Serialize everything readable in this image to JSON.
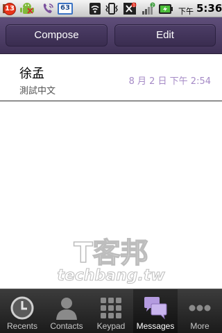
{
  "status_bar": {
    "notification_count": "13",
    "calendar_number": "63",
    "ampm": "下午",
    "time": "5:36",
    "signal_badge": "1",
    "bars_badge": "2"
  },
  "action_bar": {
    "compose_label": "Compose",
    "edit_label": "Edit"
  },
  "messages": [
    {
      "name": "徐孟",
      "preview": "測試中文",
      "time": "8 月 2 日 下午 2:54"
    }
  ],
  "watermark": {
    "top": "T客邦",
    "bottom": "techbang.tw"
  },
  "tabs": [
    {
      "label": "Recents",
      "icon": "clock-icon",
      "active": false
    },
    {
      "label": "Contacts",
      "icon": "person-icon",
      "active": false
    },
    {
      "label": "Keypad",
      "icon": "keypad-icon",
      "active": false
    },
    {
      "label": "Messages",
      "icon": "chat-bubbles-icon",
      "active": true
    },
    {
      "label": "More",
      "icon": "more-dots-icon",
      "active": false
    }
  ],
  "colors": {
    "accent": "#5f4e7a",
    "timestamp": "#a58ac6",
    "tab_active_icon": "#b49be0"
  }
}
